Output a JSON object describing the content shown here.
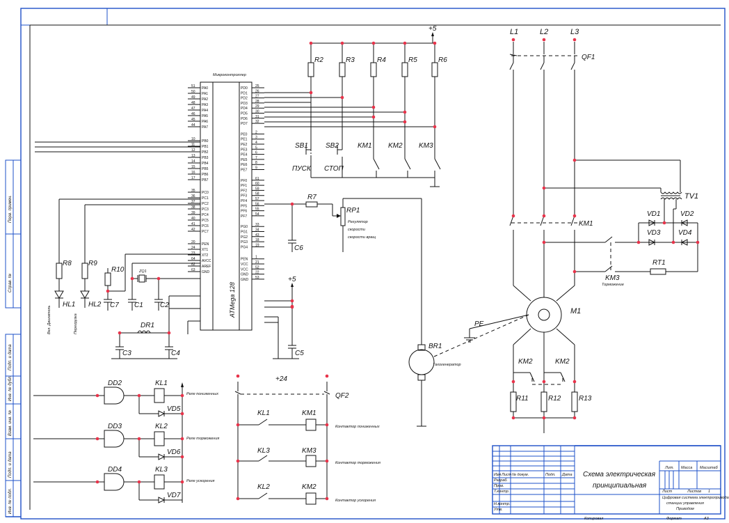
{
  "title_block": {
    "title_line1": "Схема электрическая",
    "title_line2": "принципиальная",
    "header_cells": [
      "Изм",
      "Лист",
      "№ докум.",
      "Подп.",
      "Дата"
    ],
    "role_rows": [
      "Разраб.",
      "Пров.",
      "Т.контр.",
      "Н.контр.",
      "Утв."
    ],
    "lit_header": "Лит.",
    "mass_header": "Масса",
    "scale_header": "Масштаб",
    "sheet_label": "Лист",
    "sheets_label": "Листов",
    "sheets_count": "1",
    "org_line1": "Цифровая система электропривода",
    "org_line2": "станции управления",
    "org_line3": "Приводом",
    "copied": "Копировал",
    "format": "Формат",
    "format_value": "А3"
  },
  "left_strip": {
    "cells": [
      "Перв. примен.",
      "Справ. №",
      "Подп. и дата",
      "Инв. № дубл.",
      "Взам. инв. №",
      "Подп. и дата",
      "Инв. № подл."
    ]
  },
  "mcu": {
    "name": "Микроконтроллер",
    "part": "ATMega 128",
    "left_pins": [
      "PA0",
      "PA1",
      "PA2",
      "PA3",
      "PA4",
      "PA5",
      "PA6",
      "PA7",
      "PB0",
      "PB1",
      "PB2",
      "PB3",
      "PB4",
      "PB5",
      "PB6",
      "PB7",
      "PC0",
      "PC1",
      "PC2",
      "PC3",
      "PC4",
      "PC5",
      "PC6",
      "PC7",
      "PEN",
      "XT1",
      "XT2",
      "AVCC",
      "AREF",
      "GND"
    ],
    "left_nums": [
      "51",
      "50",
      "49",
      "48",
      "47",
      "46",
      "45",
      "44",
      "10",
      "11",
      "12",
      "13",
      "14",
      "15",
      "16",
      "17",
      "35",
      "36",
      "37",
      "38",
      "39",
      "40",
      "41",
      "42",
      "20",
      "24",
      "23",
      "64",
      "62",
      "63"
    ],
    "right_pins": [
      "PD0",
      "PD1",
      "PD2",
      "PD3",
      "PD4",
      "PD5",
      "PD6",
      "PD7",
      "PE0",
      "PE1",
      "PE2",
      "PE3",
      "PE4",
      "PE5",
      "PE6",
      "PE7",
      "PF0",
      "PF1",
      "PF2",
      "PF3",
      "PF4",
      "PF5",
      "PF6",
      "PF7",
      "PG0",
      "PG1",
      "PG2",
      "PG3",
      "PG4",
      "PEN",
      "VCC",
      "VCC",
      "GND",
      "GND"
    ],
    "right_nums": [
      "25",
      "26",
      "27",
      "28",
      "29",
      "30",
      "31",
      "32",
      "2",
      "3",
      "4",
      "5",
      "6",
      "7",
      "8",
      "9",
      "61",
      "60",
      "59",
      "58",
      "57",
      "56",
      "55",
      "54",
      "33",
      "34",
      "43",
      "18",
      "19",
      "1",
      "21",
      "52",
      "22",
      "53"
    ]
  },
  "components": {
    "supply5": "+5",
    "supply5b": "+5",
    "supply24": "+24",
    "R2": "R2",
    "R3": "R3",
    "R4": "R4",
    "R5": "R5",
    "R6": "R6",
    "R7": "R7",
    "R8": "R8",
    "R9": "R9",
    "R10": "R10",
    "R11": "R11",
    "R12": "R12",
    "R13": "R13",
    "RP1": "RP1",
    "RP1_note": [
      "Регулятор",
      "скорости",
      "скорости вращ"
    ],
    "SB1": "SB1",
    "SB1_note": "ПУСК",
    "SB2": "SB2",
    "SB2_note": "СТОП",
    "KM1a": "KM1",
    "KM2a": "KM2",
    "KM3a": "KM3",
    "C1": "C1",
    "C2": "C2",
    "C3": "C3",
    "C4": "C4",
    "C5": "C5",
    "C6": "C6",
    "C7": "C7",
    "ZQ1": "ZQ1",
    "DR1": "DR1",
    "HL1": "HL1",
    "HL1_note": "Вкл. Двигатель",
    "HL2": "HL2",
    "HL2_note": "Перегрузка",
    "L1": "L1",
    "L2": "L2",
    "L3": "L3",
    "QF1": "QF1",
    "QF2": "QF2",
    "TV1": "TV1",
    "VD1": "VD1",
    "VD2": "VD2",
    "VD3": "VD3",
    "VD4": "VD4",
    "VD5": "VD5",
    "VD6": "VD6",
    "VD7": "VD7",
    "KM1_main": "KM1",
    "KM3_main": "KM3",
    "KM3_note": "Торможение",
    "RT1": "RT1",
    "M1": "M1",
    "PE": "PE",
    "BR1": "BR1",
    "BR1_note": "Тахогенератор",
    "KM2_left": "KM2",
    "KM2_right": "KM2",
    "DD2": "DD2",
    "DD3": "DD3",
    "DD4": "DD4",
    "KL1": "KL1",
    "KL2": "KL2",
    "KL3": "KL3",
    "KL1_note": "Реле пониженных",
    "KL2_note": "Реле торможения",
    "KL3_note": "Реле ускорения",
    "row1_kl": "KL1",
    "row1_km": "KM1",
    "row1_note": "Контактор пониженных",
    "row2_kl": "KL3",
    "row2_km": "KM3",
    "row2_note": "Контактор торможения",
    "row3_kl": "KL2",
    "row3_km": "KM2",
    "row3_note": "Контактор ускорения"
  }
}
